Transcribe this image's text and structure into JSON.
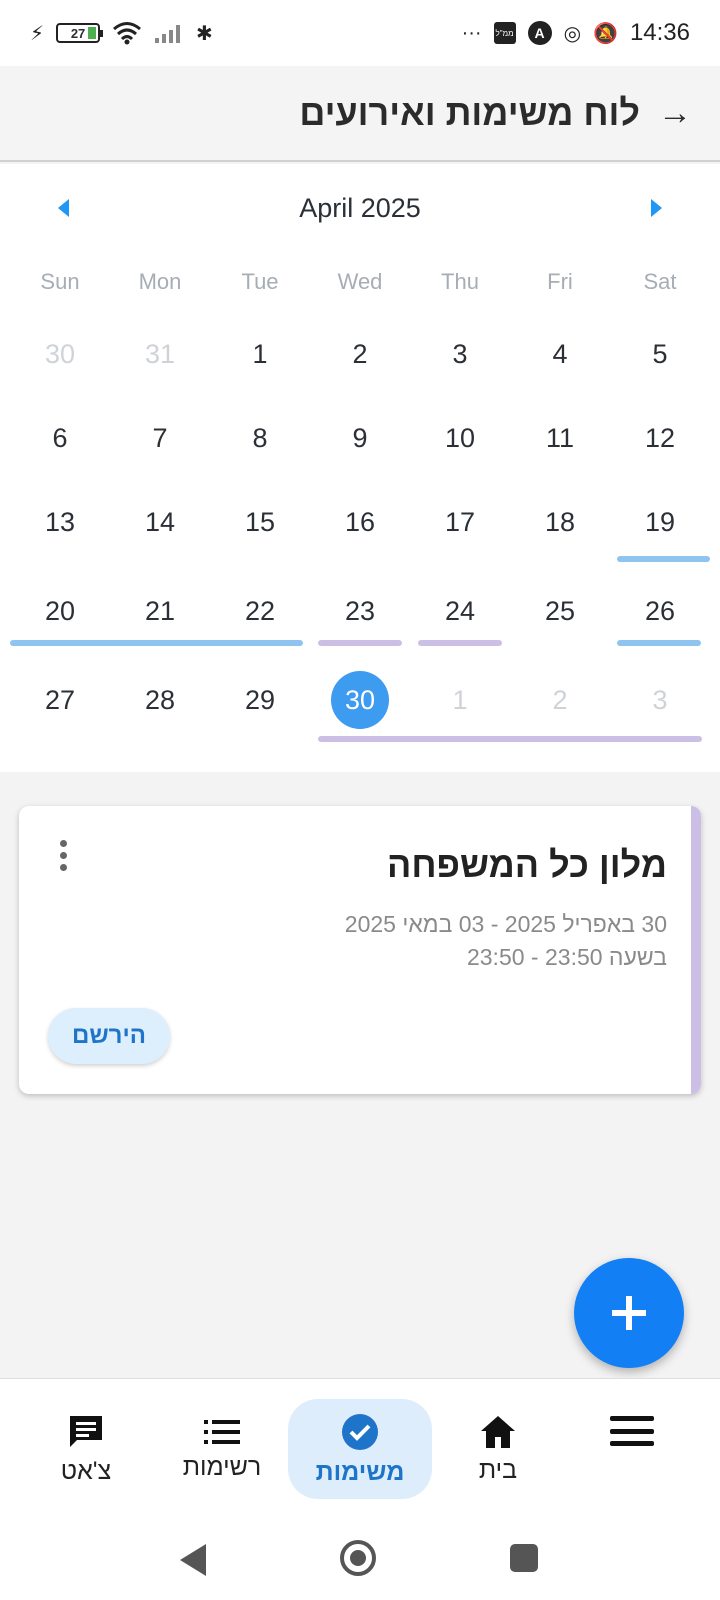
{
  "status_bar": {
    "time": "14:36",
    "battery": "27",
    "more": "···",
    "app_box": "ממ\"ל",
    "app_circle": "A"
  },
  "app_bar": {
    "title": "לוח משימות ואירועים",
    "back_icon": "arrow-right-icon"
  },
  "calendar": {
    "month": "April 2025",
    "weekdays": [
      "Sun",
      "Mon",
      "Tue",
      "Wed",
      "Thu",
      "Fri",
      "Sat"
    ],
    "weeks": [
      [
        "30",
        "31",
        "1",
        "2",
        "3",
        "4",
        "5"
      ],
      [
        "6",
        "7",
        "8",
        "9",
        "10",
        "11",
        "12"
      ],
      [
        "13",
        "14",
        "15",
        "16",
        "17",
        "18",
        "19"
      ],
      [
        "20",
        "21",
        "22",
        "23",
        "24",
        "25",
        "26"
      ],
      [
        "27",
        "28",
        "29",
        "30",
        "1",
        "2",
        "3"
      ]
    ],
    "selected_day": "30",
    "colors": {
      "event_blue": "#90c4f0",
      "event_purple": "#cbbfe5",
      "today": "#3d9bf0"
    }
  },
  "event": {
    "title": "מלון כל המשפחה",
    "dates": "30 באפריל 2025 - 03 במאי 2025",
    "time": "בשעה 23:50 - 23:50",
    "register_label": "הירשם",
    "accent_color": "#cbbfe5"
  },
  "fab": {
    "icon": "plus-icon",
    "color": "#137ff5"
  },
  "bottom_nav": {
    "items": [
      {
        "label": "צ'אט",
        "icon": "chat-icon"
      },
      {
        "label": "רשימות",
        "icon": "list-icon"
      },
      {
        "label": "משימות",
        "icon": "check-circle-icon"
      },
      {
        "label": "בית",
        "icon": "home-icon"
      }
    ],
    "menu_icon": "hamburger-icon",
    "accent": "#1e74c8"
  }
}
